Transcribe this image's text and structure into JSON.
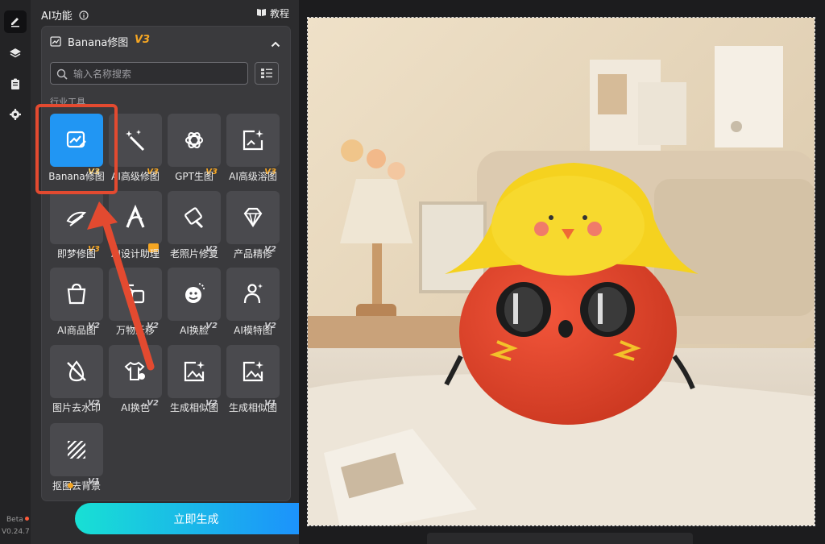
{
  "rail": {
    "beta": "Beta",
    "version": "V0.24.7",
    "items": [
      "edit-icon",
      "layers-icon",
      "clipboard-icon",
      "gear-icon"
    ]
  },
  "panel": {
    "title": "AI功能",
    "tutorial": "教程",
    "card": {
      "label": "Banana修图",
      "version": "V3"
    },
    "search": {
      "placeholder": "输入名称搜索"
    },
    "section": "行业工具",
    "tools": [
      {
        "name": "Banana修图",
        "ver": "V3",
        "icon": "image-edit-icon",
        "selected": true
      },
      {
        "name": "AI高级修图",
        "ver": "V3",
        "icon": "magic-wand-icon"
      },
      {
        "name": "GPT生图",
        "ver": "V3",
        "icon": "openai-icon"
      },
      {
        "name": "AI高级溶图",
        "ver": "V3",
        "icon": "sparkle-frame-icon"
      },
      {
        "name": "即梦修图",
        "ver": "V3",
        "icon": "dream-icon"
      },
      {
        "name": "AI设计助理",
        "ver": "",
        "icon": "design-a-icon"
      },
      {
        "name": "老照片修复",
        "ver": "V2",
        "icon": "photo-repair-icon"
      },
      {
        "name": "产品精修",
        "ver": "V2",
        "icon": "diamond-icon"
      },
      {
        "name": "AI商品图",
        "ver": "V2",
        "icon": "shopping-bag-icon"
      },
      {
        "name": "万物迁移",
        "ver": "V2",
        "icon": "transfer-icon"
      },
      {
        "name": "AI换脸",
        "ver": "V2",
        "icon": "face-swap-icon"
      },
      {
        "name": "AI模特图",
        "ver": "V2",
        "icon": "model-person-icon"
      },
      {
        "name": "图片去水印",
        "ver": "V2",
        "icon": "no-watermark-icon"
      },
      {
        "name": "AI换色",
        "ver": "V2",
        "icon": "recolor-shirt-icon"
      },
      {
        "name": "生成相似图",
        "ver": "V2",
        "icon": "similar-image-icon"
      },
      {
        "name": "生成相似图",
        "ver": "V1",
        "icon": "similar-image-icon"
      },
      {
        "name": "抠图去背景",
        "ver": "V1",
        "icon": "cutout-icon"
      }
    ],
    "generate": "立即生成"
  },
  "colors": {
    "accent": "#2196f3",
    "version": "#f5a623",
    "annotation": "#e34a30"
  }
}
